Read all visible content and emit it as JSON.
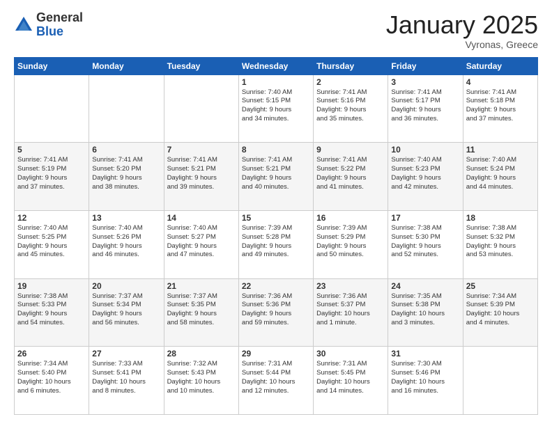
{
  "logo": {
    "general": "General",
    "blue": "Blue"
  },
  "title": "January 2025",
  "location": "Vyronas, Greece",
  "days_header": [
    "Sunday",
    "Monday",
    "Tuesday",
    "Wednesday",
    "Thursday",
    "Friday",
    "Saturday"
  ],
  "weeks": [
    [
      {
        "day": "",
        "info": ""
      },
      {
        "day": "",
        "info": ""
      },
      {
        "day": "",
        "info": ""
      },
      {
        "day": "1",
        "info": "Sunrise: 7:40 AM\nSunset: 5:15 PM\nDaylight: 9 hours\nand 34 minutes."
      },
      {
        "day": "2",
        "info": "Sunrise: 7:41 AM\nSunset: 5:16 PM\nDaylight: 9 hours\nand 35 minutes."
      },
      {
        "day": "3",
        "info": "Sunrise: 7:41 AM\nSunset: 5:17 PM\nDaylight: 9 hours\nand 36 minutes."
      },
      {
        "day": "4",
        "info": "Sunrise: 7:41 AM\nSunset: 5:18 PM\nDaylight: 9 hours\nand 37 minutes."
      }
    ],
    [
      {
        "day": "5",
        "info": "Sunrise: 7:41 AM\nSunset: 5:19 PM\nDaylight: 9 hours\nand 37 minutes."
      },
      {
        "day": "6",
        "info": "Sunrise: 7:41 AM\nSunset: 5:20 PM\nDaylight: 9 hours\nand 38 minutes."
      },
      {
        "day": "7",
        "info": "Sunrise: 7:41 AM\nSunset: 5:21 PM\nDaylight: 9 hours\nand 39 minutes."
      },
      {
        "day": "8",
        "info": "Sunrise: 7:41 AM\nSunset: 5:21 PM\nDaylight: 9 hours\nand 40 minutes."
      },
      {
        "day": "9",
        "info": "Sunrise: 7:41 AM\nSunset: 5:22 PM\nDaylight: 9 hours\nand 41 minutes."
      },
      {
        "day": "10",
        "info": "Sunrise: 7:40 AM\nSunset: 5:23 PM\nDaylight: 9 hours\nand 42 minutes."
      },
      {
        "day": "11",
        "info": "Sunrise: 7:40 AM\nSunset: 5:24 PM\nDaylight: 9 hours\nand 44 minutes."
      }
    ],
    [
      {
        "day": "12",
        "info": "Sunrise: 7:40 AM\nSunset: 5:25 PM\nDaylight: 9 hours\nand 45 minutes."
      },
      {
        "day": "13",
        "info": "Sunrise: 7:40 AM\nSunset: 5:26 PM\nDaylight: 9 hours\nand 46 minutes."
      },
      {
        "day": "14",
        "info": "Sunrise: 7:40 AM\nSunset: 5:27 PM\nDaylight: 9 hours\nand 47 minutes."
      },
      {
        "day": "15",
        "info": "Sunrise: 7:39 AM\nSunset: 5:28 PM\nDaylight: 9 hours\nand 49 minutes."
      },
      {
        "day": "16",
        "info": "Sunrise: 7:39 AM\nSunset: 5:29 PM\nDaylight: 9 hours\nand 50 minutes."
      },
      {
        "day": "17",
        "info": "Sunrise: 7:38 AM\nSunset: 5:30 PM\nDaylight: 9 hours\nand 52 minutes."
      },
      {
        "day": "18",
        "info": "Sunrise: 7:38 AM\nSunset: 5:32 PM\nDaylight: 9 hours\nand 53 minutes."
      }
    ],
    [
      {
        "day": "19",
        "info": "Sunrise: 7:38 AM\nSunset: 5:33 PM\nDaylight: 9 hours\nand 54 minutes."
      },
      {
        "day": "20",
        "info": "Sunrise: 7:37 AM\nSunset: 5:34 PM\nDaylight: 9 hours\nand 56 minutes."
      },
      {
        "day": "21",
        "info": "Sunrise: 7:37 AM\nSunset: 5:35 PM\nDaylight: 9 hours\nand 58 minutes."
      },
      {
        "day": "22",
        "info": "Sunrise: 7:36 AM\nSunset: 5:36 PM\nDaylight: 9 hours\nand 59 minutes."
      },
      {
        "day": "23",
        "info": "Sunrise: 7:36 AM\nSunset: 5:37 PM\nDaylight: 10 hours\nand 1 minute."
      },
      {
        "day": "24",
        "info": "Sunrise: 7:35 AM\nSunset: 5:38 PM\nDaylight: 10 hours\nand 3 minutes."
      },
      {
        "day": "25",
        "info": "Sunrise: 7:34 AM\nSunset: 5:39 PM\nDaylight: 10 hours\nand 4 minutes."
      }
    ],
    [
      {
        "day": "26",
        "info": "Sunrise: 7:34 AM\nSunset: 5:40 PM\nDaylight: 10 hours\nand 6 minutes."
      },
      {
        "day": "27",
        "info": "Sunrise: 7:33 AM\nSunset: 5:41 PM\nDaylight: 10 hours\nand 8 minutes."
      },
      {
        "day": "28",
        "info": "Sunrise: 7:32 AM\nSunset: 5:43 PM\nDaylight: 10 hours\nand 10 minutes."
      },
      {
        "day": "29",
        "info": "Sunrise: 7:31 AM\nSunset: 5:44 PM\nDaylight: 10 hours\nand 12 minutes."
      },
      {
        "day": "30",
        "info": "Sunrise: 7:31 AM\nSunset: 5:45 PM\nDaylight: 10 hours\nand 14 minutes."
      },
      {
        "day": "31",
        "info": "Sunrise: 7:30 AM\nSunset: 5:46 PM\nDaylight: 10 hours\nand 16 minutes."
      },
      {
        "day": "",
        "info": ""
      }
    ]
  ]
}
